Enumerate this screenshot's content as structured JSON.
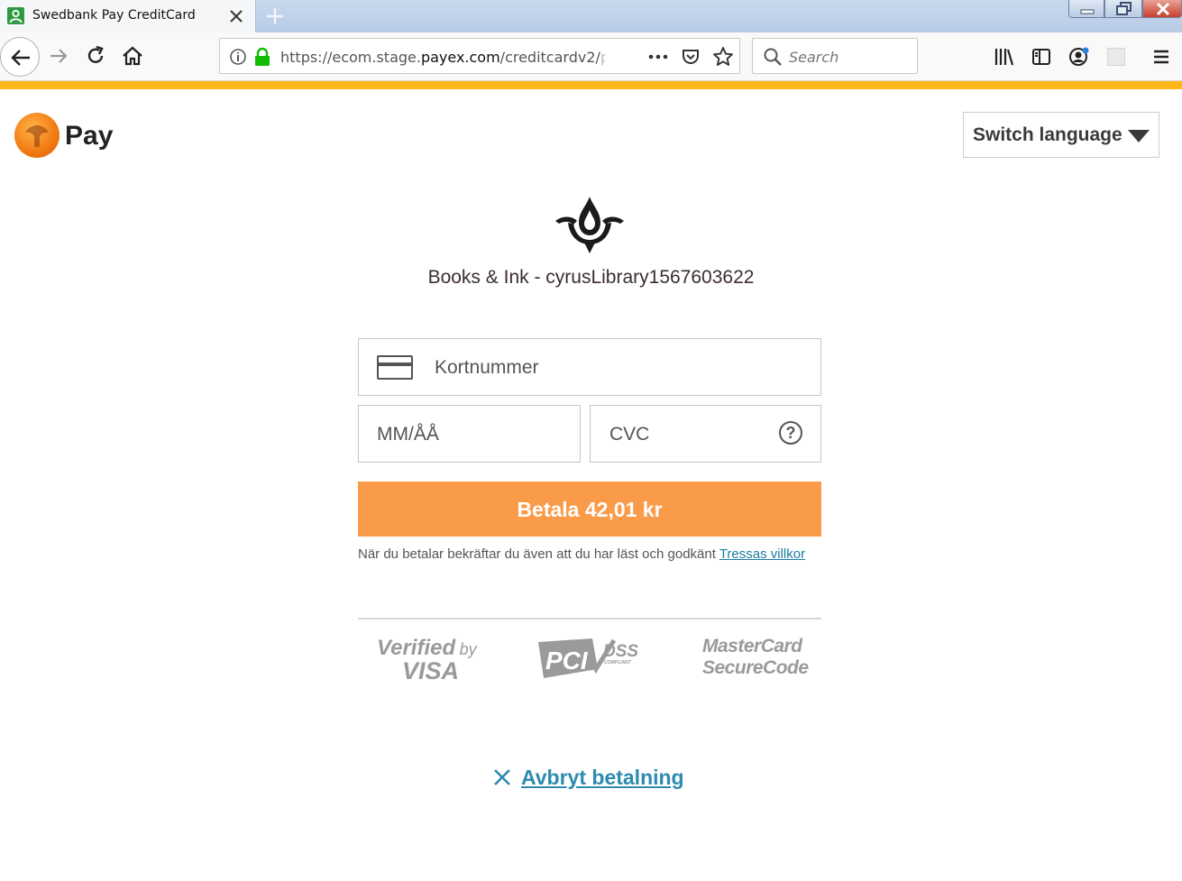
{
  "browser": {
    "tab_title": "Swedbank Pay CreditCard",
    "url_prefix": "https://ecom.stage.",
    "url_domain": "payex.com",
    "url_path": "/creditcardv2/",
    "url_fade": "pa",
    "search_placeholder": "Search",
    "colors": {
      "accent_strip": "#fdb71a"
    }
  },
  "header": {
    "brand": "Pay",
    "language_button": "Switch language"
  },
  "merchant": {
    "name": "Books & Ink - cyrusLibrary1567603622"
  },
  "form": {
    "card_number_placeholder": "Kortnummer",
    "expiry_placeholder": "MM/ÅÅ",
    "cvc_placeholder": "CVC",
    "pay_button": "Betala 42,01 kr",
    "terms_text": "När du betalar bekräftar du även att du har läst och godkänt ",
    "terms_link": "Tressas villkor",
    "pay_color": "#fa9b4a"
  },
  "badges": {
    "visa_top": "Verified",
    "visa_by": "by",
    "visa_bottom": "VISA",
    "pci_text": "PCI",
    "pci_dss": "DSS",
    "pci_compliant": "COMPLIANT",
    "mc_line1": "MasterCard",
    "mc_line2": "SecureCode"
  },
  "footer": {
    "cancel_label": "Avbryt betalning"
  }
}
